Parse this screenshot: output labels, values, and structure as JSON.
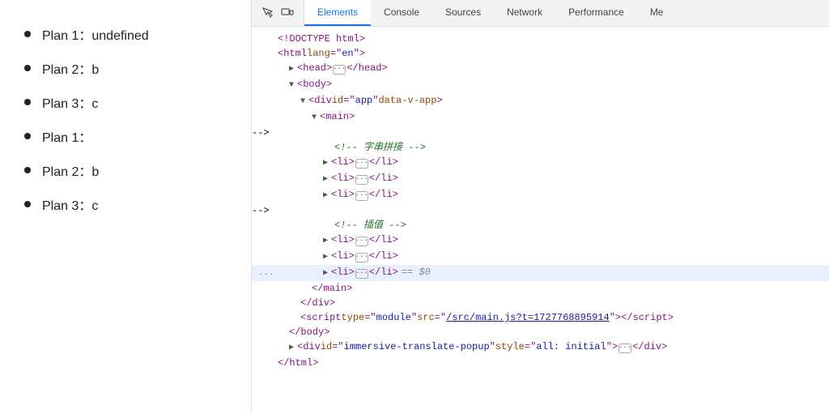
{
  "left_panel": {
    "items": [
      {
        "id": 1,
        "text": "Plan 1：undefined"
      },
      {
        "id": 2,
        "text": "Plan 2：b"
      },
      {
        "id": 3,
        "text": "Plan 3：c"
      },
      {
        "id": 4,
        "text": "Plan 1："
      },
      {
        "id": 5,
        "text": "Plan 2：b"
      },
      {
        "id": 6,
        "text": "Plan 3：c"
      }
    ]
  },
  "devtools": {
    "tabs": [
      {
        "id": "elements",
        "label": "Elements",
        "active": true
      },
      {
        "id": "console",
        "label": "Console",
        "active": false
      },
      {
        "id": "sources",
        "label": "Sources",
        "active": false
      },
      {
        "id": "network",
        "label": "Network",
        "active": false
      },
      {
        "id": "performance",
        "label": "Performance",
        "active": false
      },
      {
        "id": "more",
        "label": "Me",
        "active": false
      }
    ],
    "code_lines": [
      {
        "indent": 0,
        "prefix": "",
        "content": "doctype",
        "type": "doctype"
      },
      {
        "indent": 0,
        "prefix": "",
        "content": "html_open",
        "type": "html"
      },
      {
        "indent": 1,
        "prefix": "▶",
        "content": "head",
        "type": "collapsed"
      },
      {
        "indent": 1,
        "prefix": "▼",
        "content": "body_open",
        "type": "body"
      },
      {
        "indent": 2,
        "prefix": "▼",
        "content": "div_app",
        "type": "div"
      },
      {
        "indent": 3,
        "prefix": "▼",
        "content": "main_open",
        "type": "main"
      },
      {
        "indent": 4,
        "prefix": "",
        "content": "comment_concat",
        "type": "comment"
      },
      {
        "indent": 4,
        "prefix": "▶",
        "content": "li1",
        "type": "li"
      },
      {
        "indent": 4,
        "prefix": "▶",
        "content": "li2",
        "type": "li"
      },
      {
        "indent": 4,
        "prefix": "▶",
        "content": "li3",
        "type": "li"
      },
      {
        "indent": 4,
        "prefix": "",
        "content": "comment_insert",
        "type": "comment"
      },
      {
        "indent": 4,
        "prefix": "▶",
        "content": "li4",
        "type": "li"
      },
      {
        "indent": 4,
        "prefix": "▶",
        "content": "li5",
        "type": "li"
      },
      {
        "indent": 4,
        "prefix": "▶",
        "content": "li6_selected",
        "type": "li_selected"
      },
      {
        "indent": 3,
        "prefix": "",
        "content": "main_close",
        "type": "main_close"
      },
      {
        "indent": 2,
        "prefix": "",
        "content": "div_close",
        "type": "div_close"
      },
      {
        "indent": 2,
        "prefix": "",
        "content": "script_tag",
        "type": "script"
      },
      {
        "indent": 1,
        "prefix": "",
        "content": "body_close",
        "type": "body_close"
      },
      {
        "indent": 1,
        "prefix": "▶",
        "content": "div_immersive",
        "type": "div_immersive"
      },
      {
        "indent": 0,
        "prefix": "",
        "content": "html_close",
        "type": "html_close"
      }
    ]
  }
}
